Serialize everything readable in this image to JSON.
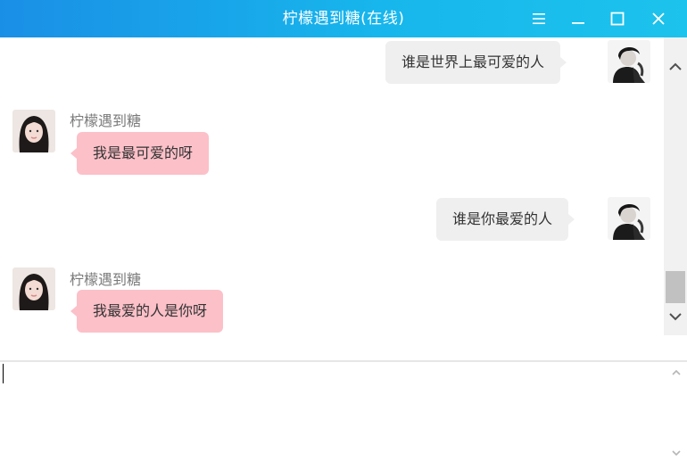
{
  "window": {
    "title": "柠檬遇到糖(在线)",
    "accent_start": "#1a8fe6",
    "accent_end": "#1cc3ec",
    "controls": [
      "menu-icon",
      "minimize-icon",
      "maximize-icon",
      "close-icon"
    ]
  },
  "messages": [
    {
      "side": "right",
      "sender": "",
      "text": "谁是世界上最可爱的人",
      "bubble_color": "#efefef"
    },
    {
      "side": "left",
      "sender": "柠檬遇到糖",
      "text": "我是最可爱的呀",
      "bubble_color": "#fcc0c8"
    },
    {
      "side": "right",
      "sender": "",
      "text": "谁是你最爱的人",
      "bubble_color": "#efefef"
    },
    {
      "side": "left",
      "sender": "柠檬遇到糖",
      "text": "我最爱的人是你呀",
      "bubble_color": "#fcc0c8"
    }
  ],
  "input": {
    "value": "",
    "placeholder": ""
  }
}
